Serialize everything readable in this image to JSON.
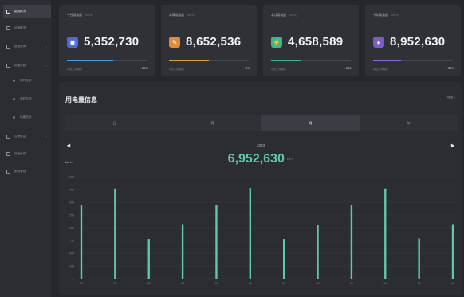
{
  "sidebar": {
    "items": [
      {
        "label": "能耗概况",
        "active": true,
        "arrow": ""
      },
      {
        "label": "设备概况",
        "active": false,
        "arrow": ""
      },
      {
        "label": "数据查询",
        "active": false,
        "arrow": "›"
      },
      {
        "label": "设备控制",
        "active": false,
        "arrow": "›"
      },
      {
        "label": "实时控制",
        "active": false,
        "arrow": "",
        "sub": true
      },
      {
        "label": "定时控制",
        "active": false,
        "arrow": "",
        "sub": true
      },
      {
        "label": "场景控制",
        "active": false,
        "arrow": "",
        "sub": true
      },
      {
        "label": "告警信息",
        "active": false,
        "arrow": "›"
      },
      {
        "label": "设备维护",
        "active": false,
        "arrow": ""
      },
      {
        "label": "系统管理",
        "active": false,
        "arrow": ""
      }
    ]
  },
  "cards": [
    {
      "title": "今日用电量",
      "unit": "(kw·h)",
      "value": "5,352,730",
      "icon": "calendar-icon",
      "glyph": "▣",
      "color": "#4a6bd8",
      "bar_fraction": 0.58,
      "bar_color": "#4a9bd8",
      "foot": "同比上月增长",
      "pct": "+58%"
    },
    {
      "title": "本周用电量",
      "unit": "(kw·h)",
      "value": "8,652,536",
      "icon": "plug-icon",
      "glyph": "✎",
      "color": "#e08a3c",
      "bar_fraction": 0.5,
      "bar_color": "#d9a23a",
      "foot": "同比上周增长",
      "pct": "+7%"
    },
    {
      "title": "本月用电量",
      "unit": "(kw·h)",
      "value": "4,658,589",
      "icon": "lightning-icon",
      "glyph": "⚡",
      "color": "#3fb58e",
      "bar_fraction": 0.38,
      "bar_color": "#3fb58e",
      "foot": "同比上月增长",
      "pct": "+28%"
    },
    {
      "title": "今年用电量",
      "unit": "(kw·h)",
      "value": "8,952,630",
      "icon": "bulb-icon",
      "glyph": "●",
      "color": "#7a5cc8",
      "bar_fraction": 0.35,
      "bar_color": "#8a6bd8",
      "foot": "同比去年增长",
      "pct": "+39%"
    }
  ],
  "panel": {
    "title": "用电量信息",
    "export_label": "导出 ⌄",
    "tabs": [
      {
        "label": "日",
        "active": false
      },
      {
        "label": "周",
        "active": false
      },
      {
        "label": "月",
        "active": true
      },
      {
        "label": "年",
        "active": false
      }
    ],
    "prev_glyph": "◂",
    "next_glyph": "▸",
    "year": "2023",
    "total": "6,952,630",
    "total_unit": "kw·h",
    "y_axis_label": "kw·h"
  },
  "chart_data": {
    "type": "bar",
    "categories": [
      "01",
      "02",
      "03",
      "04",
      "05",
      "06",
      "07",
      "08",
      "09",
      "10",
      "11",
      "12"
    ],
    "values": [
      1450,
      1770,
      780,
      1070,
      1450,
      1780,
      780,
      1050,
      1450,
      1770,
      790,
      1070
    ],
    "yticks": [
      "0",
      "250",
      "500",
      "750",
      "1000",
      "1250",
      "1500",
      "1750",
      "2000"
    ],
    "ylim": [
      0,
      2000
    ],
    "bar_color": "#5ec9a4",
    "grid": true
  }
}
